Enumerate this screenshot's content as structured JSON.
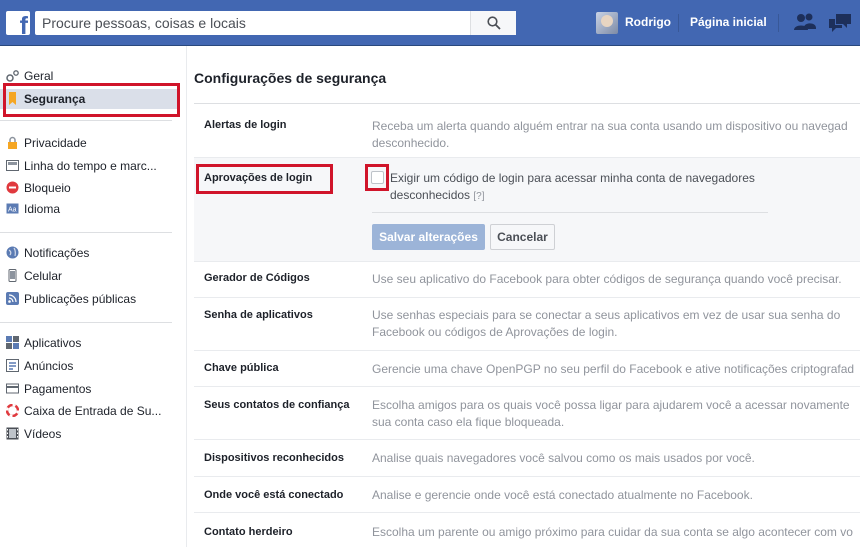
{
  "header": {
    "search_placeholder": "Procure pessoas, coisas e locais",
    "user_name": "Rodrigo",
    "home_label": "Página inicial",
    "bar_color": "#4267b2"
  },
  "sidebar": {
    "items": [
      {
        "label": "Geral",
        "icon": "gear-icon"
      },
      {
        "label": "Segurança",
        "icon": "badge-icon",
        "active": true
      },
      {
        "label": "Privacidade",
        "icon": "lock-icon"
      },
      {
        "label": "Linha do tempo e marc...",
        "icon": "timeline-icon"
      },
      {
        "label": "Bloqueio",
        "icon": "block-icon"
      },
      {
        "label": "Idioma",
        "icon": "language-icon"
      },
      {
        "label": "Notificações",
        "icon": "globe-icon"
      },
      {
        "label": "Celular",
        "icon": "phone-icon"
      },
      {
        "label": "Publicações públicas",
        "icon": "rss-icon"
      },
      {
        "label": "Aplicativos",
        "icon": "apps-icon"
      },
      {
        "label": "Anúncios",
        "icon": "ads-icon"
      },
      {
        "label": "Pagamentos",
        "icon": "card-icon"
      },
      {
        "label": "Caixa de Entrada de Su...",
        "icon": "lifebuoy-icon"
      },
      {
        "label": "Vídeos",
        "icon": "film-icon"
      }
    ]
  },
  "main": {
    "title": "Configurações de segurança",
    "rows": [
      {
        "name": "Alertas de login",
        "desc_lines": [
          "Receba um alerta quando alguém entrar na sua conta usando um dispositivo ou navegad",
          "desconhecido."
        ]
      },
      {
        "name": "Aprovações de login",
        "expanded": true
      },
      {
        "name": "Gerador de Códigos",
        "desc_lines": [
          "Use seu aplicativo do Facebook para obter códigos de segurança quando você precisar."
        ]
      },
      {
        "name": "Senha de aplicativos",
        "desc_lines": [
          "Use senhas especiais para se conectar a seus aplicativos em vez de usar sua senha do",
          "Facebook ou códigos de Aprovações de login."
        ]
      },
      {
        "name": "Chave pública",
        "desc_lines": [
          "Gerencie uma chave OpenPGP no seu perfil do Facebook e ative notificações criptografad"
        ]
      },
      {
        "name": "Seus contatos de confiança",
        "desc_lines": [
          "Escolha amigos para os quais você possa ligar para ajudarem você a acessar novamente",
          "sua conta caso ela fique bloqueada."
        ]
      },
      {
        "name": "Dispositivos reconhecidos",
        "desc_lines": [
          "Analise quais navegadores você salvou como os mais usados por você."
        ]
      },
      {
        "name": "Onde você está conectado",
        "desc_lines": [
          "Analise e gerencie onde você está conectado atualmente no Facebook."
        ]
      },
      {
        "name": "Contato herdeiro",
        "desc_lines": [
          "Escolha um parente ou amigo próximo para cuidar da sua conta se algo acontecer com vo"
        ]
      }
    ],
    "login_approvals": {
      "checkbox_line1": "Exigir um código de login para acessar minha conta de navegadores",
      "checkbox_line2": "desconhecidos",
      "help": "[?]",
      "checked": false,
      "save_label": "Salvar alterações",
      "cancel_label": "Cancelar"
    }
  },
  "annotation_color": "#d0142a"
}
